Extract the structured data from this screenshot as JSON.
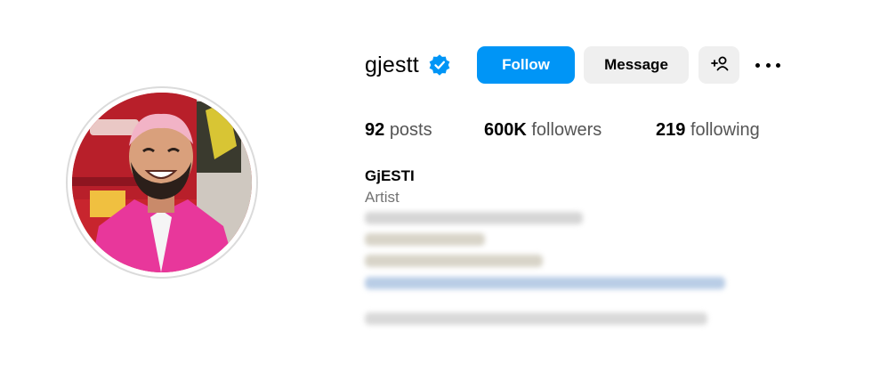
{
  "profile": {
    "username": "gjestt",
    "verified_icon": "verified-badge-icon",
    "full_name": "GjESTI",
    "category": "Artist"
  },
  "actions": {
    "follow_label": "Follow",
    "message_label": "Message",
    "add_user_icon": "add-user-icon",
    "more_icon": "more-options-icon"
  },
  "stats": {
    "posts": {
      "value": "92",
      "label": "posts"
    },
    "followers": {
      "value": "600K",
      "label": "followers"
    },
    "following": {
      "value": "219",
      "label": "following"
    }
  },
  "colors": {
    "accent": "#0095f6",
    "secondary_button": "#efefef",
    "muted_text": "#737373",
    "verified": "#0095f6",
    "avatar_jacket": "#e8379b"
  }
}
